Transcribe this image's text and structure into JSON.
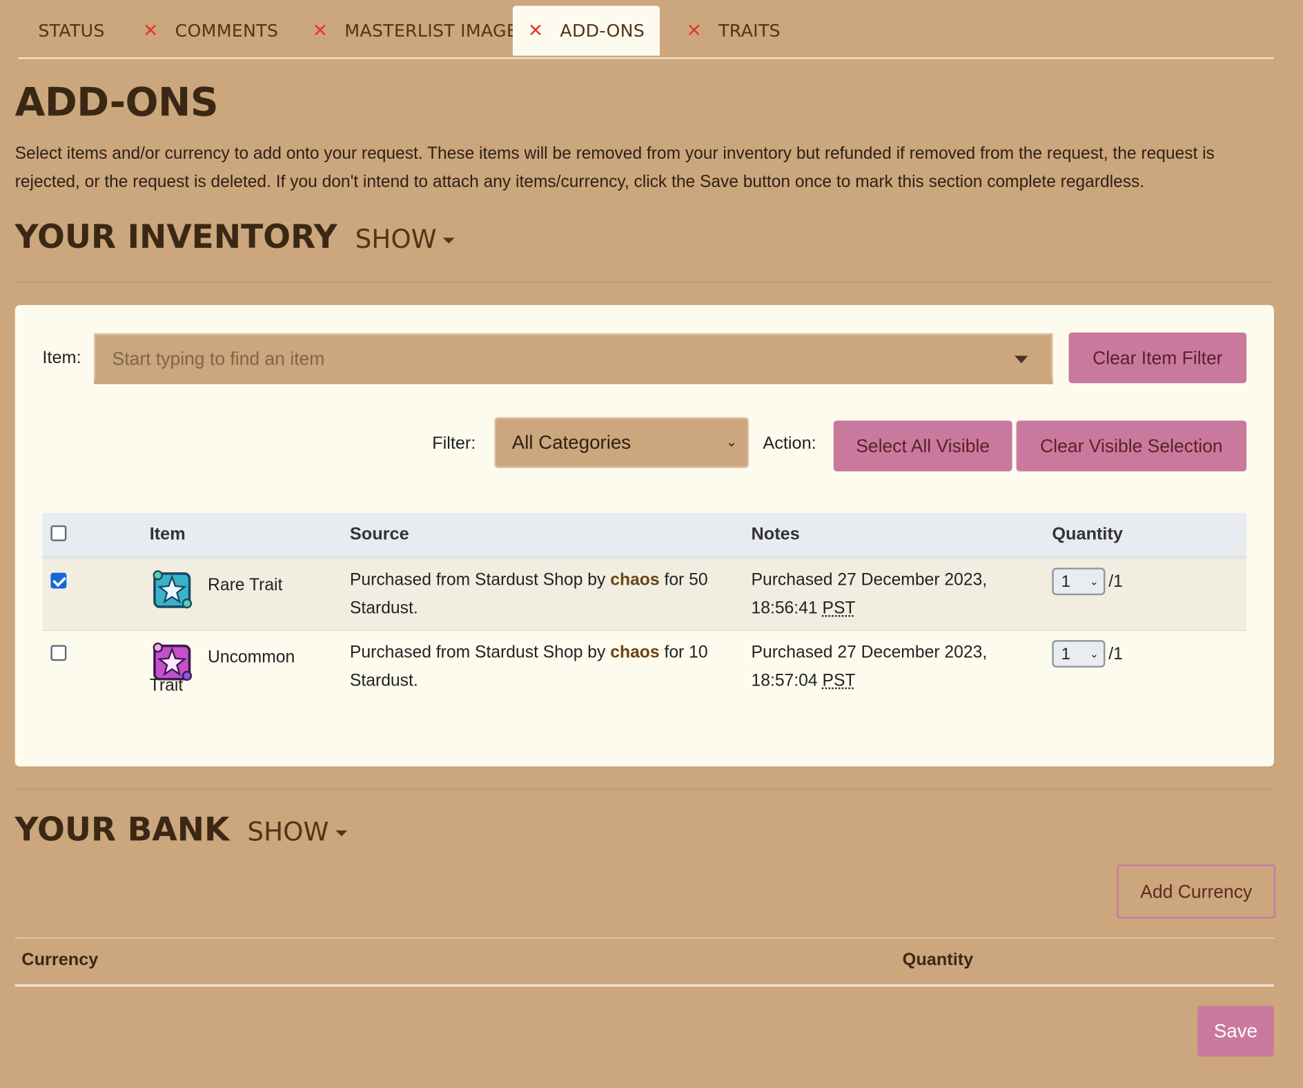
{
  "tabs": [
    {
      "label": "STATUS",
      "incomplete": false,
      "active": false
    },
    {
      "label": "COMMENTS",
      "incomplete": true,
      "active": false
    },
    {
      "label": "MASTERLIST IMAGE",
      "incomplete": true,
      "active": false
    },
    {
      "label": "ADD-ONS",
      "incomplete": true,
      "active": true
    },
    {
      "label": "TRAITS",
      "incomplete": true,
      "active": false
    }
  ],
  "tab_incomplete_icon": "close-x-icon",
  "page": {
    "title": "ADD-ONS",
    "intro": "Select items and/or currency to add onto your request. These items will be removed from your inventory but refunded if removed from the request, the request is rejected, or the request is deleted. If you don't intend to attach any items/currency, click the Save button once to mark this section complete regardless."
  },
  "inventory": {
    "heading": "YOUR INVENTORY",
    "toggle": "SHOW",
    "item_label": "Item:",
    "item_placeholder": "Start typing to find an item",
    "clear_item_filter": "Clear Item Filter",
    "filter_label": "Filter:",
    "filter_value": "All Categories",
    "action_label": "Action:",
    "select_all": "Select All Visible",
    "clear_visible": "Clear Visible Selection",
    "columns": {
      "item": "Item",
      "source": "Source",
      "notes": "Notes",
      "quantity": "Quantity"
    },
    "rows": [
      {
        "checked": true,
        "item": "Rare Trait",
        "source_prefix": "Purchased from Stardust Shop by",
        "source_user": "chaos",
        "source_suffix": "for 50 Stardust.",
        "notes_text": "Purchased 27 December 2023, 18:56:41",
        "notes_tz": "PST",
        "qty_selected": "1",
        "qty_max": "/1"
      },
      {
        "checked": false,
        "item": "Uncommon Trait",
        "source_prefix": "Purchased from Stardust Shop by",
        "source_user": "chaos",
        "source_suffix": "for 10 Stardust.",
        "notes_text": "Purchased 27 December 2023, 18:57:04",
        "notes_tz": "PST",
        "qty_selected": "1",
        "qty_max": "/1"
      }
    ]
  },
  "bank": {
    "heading": "YOUR BANK",
    "toggle": "SHOW",
    "add_currency": "Add Currency",
    "columns": {
      "currency": "Currency",
      "quantity": "Quantity"
    }
  },
  "save_label": "Save",
  "colors": {
    "background": "#cca67c",
    "card": "#fdfbee",
    "accent_button": "#c9799e",
    "incomplete_x": "#e4362f",
    "checkbox_checked": "#1666d8"
  }
}
